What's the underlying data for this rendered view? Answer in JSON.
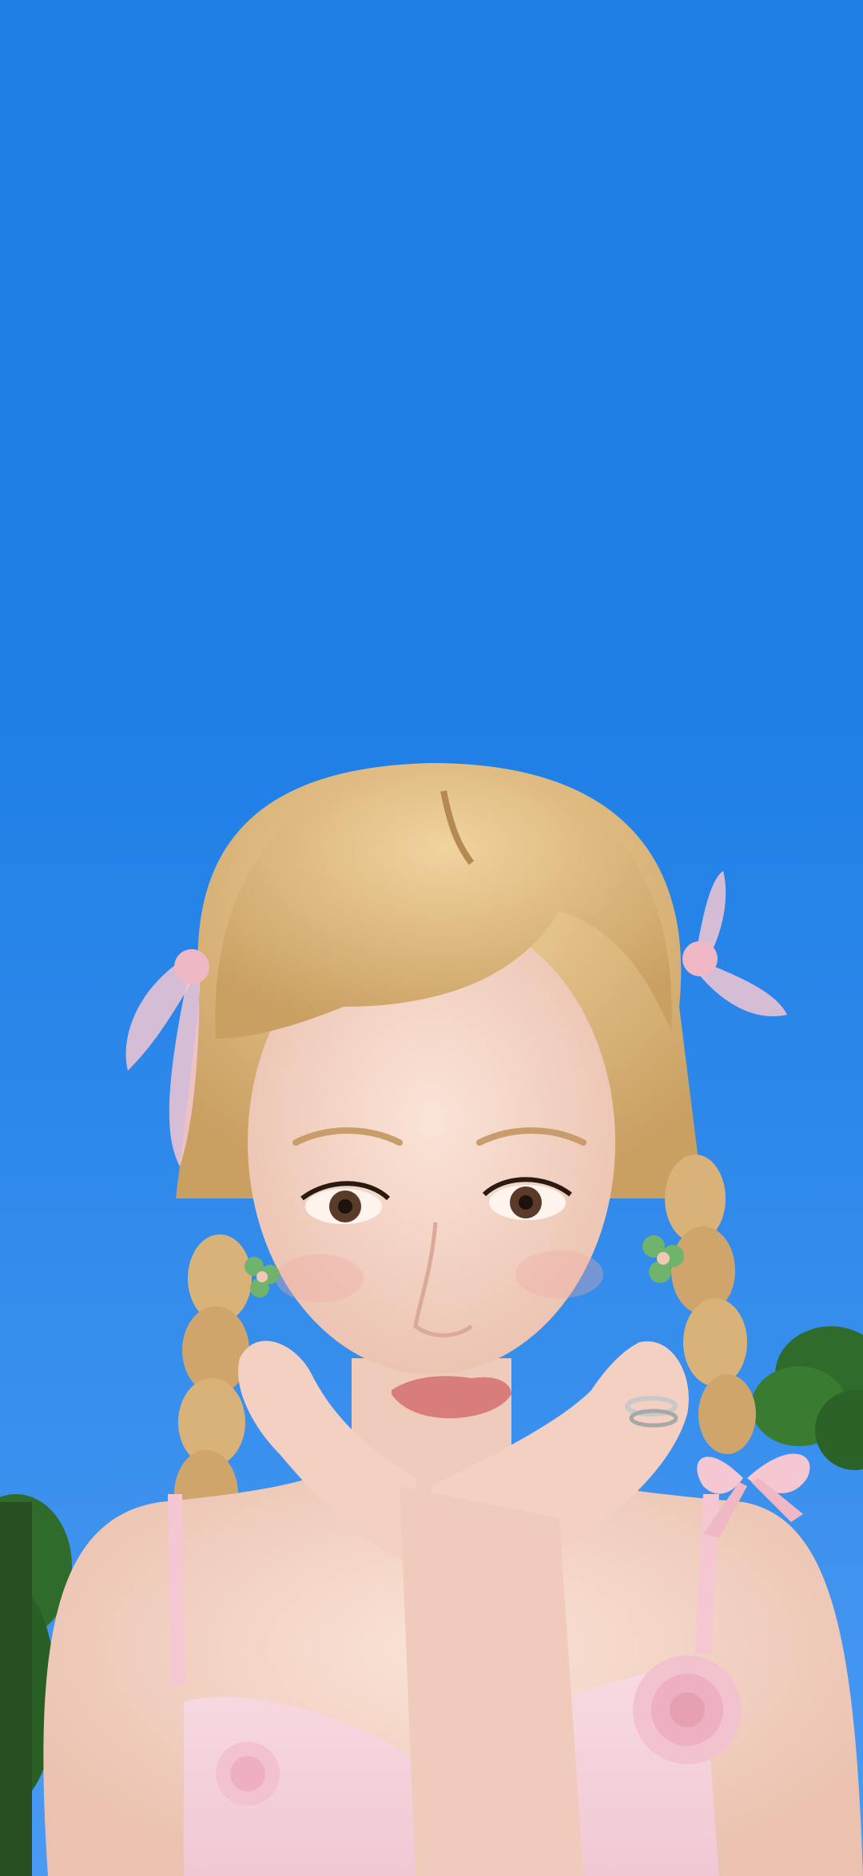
{
  "wallpaper": {
    "subject": "portrait-photo",
    "colors": {
      "sky_top": "#1f7fe6",
      "sky_bottom": "#3d8ff0",
      "hair": "#e8c48a",
      "hair_shadow": "#c9a066",
      "skin": "#f6dccf",
      "skin_shadow": "#e8bfae",
      "lips": "#d97d7a",
      "ribbon": "#f4c7d2",
      "dress": "#f6d2dc",
      "rose": "#f0b7c5",
      "tree": "#2f6b2a",
      "earring": "#6fb36c"
    }
  }
}
